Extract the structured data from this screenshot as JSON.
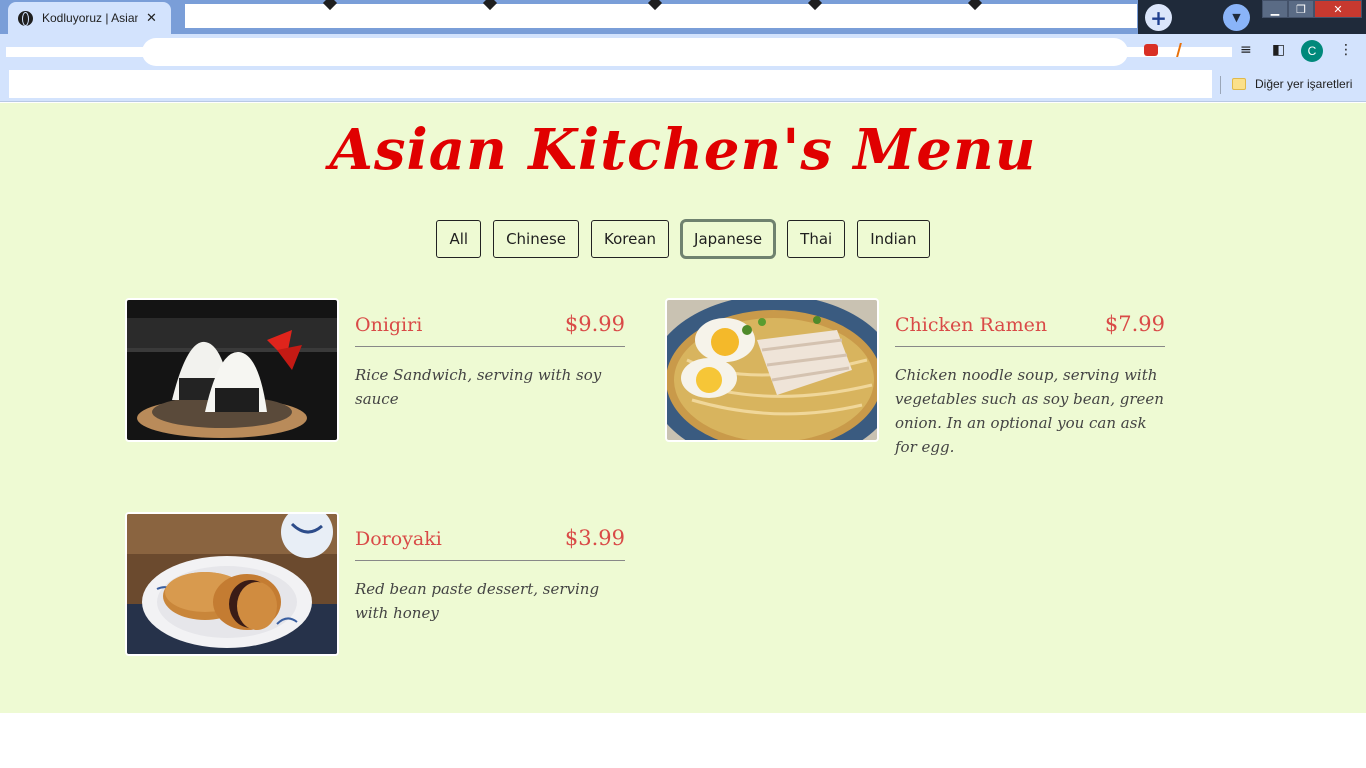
{
  "browser": {
    "tab_title": "Kodluyoruz | Asian Kitchen",
    "tab_close": "✕",
    "new_tab": "+",
    "avatar_letter": "C",
    "bookmarks_other": "Diğer yer işaretleri"
  },
  "page": {
    "title": "Asian Kitchen's Menu",
    "filters": [
      {
        "label": "All",
        "active": false
      },
      {
        "label": "Chinese",
        "active": false
      },
      {
        "label": "Korean",
        "active": false
      },
      {
        "label": "Japanese",
        "active": true
      },
      {
        "label": "Thai",
        "active": false
      },
      {
        "label": "Indian",
        "active": false
      }
    ],
    "menu_items": [
      {
        "name": "Onigiri",
        "price": "$9.99",
        "desc": "Rice Sandwich, serving with soy sauce",
        "image": "onigiri-photo"
      },
      {
        "name": "Chicken Ramen",
        "price": "$7.99",
        "desc": "Chicken noodle soup, serving with vegetables such as soy bean, green onion. In an optional you can ask for egg.",
        "image": "ramen-photo"
      },
      {
        "name": "Doroyaki",
        "price": "$3.99",
        "desc": "Red bean paste dessert, serving with honey",
        "image": "dorayaki-photo"
      }
    ]
  },
  "colors": {
    "page_bg": "#eefad3",
    "title": "#e00000",
    "accent": "#d94a47",
    "chrome": "#d3e3fd"
  }
}
